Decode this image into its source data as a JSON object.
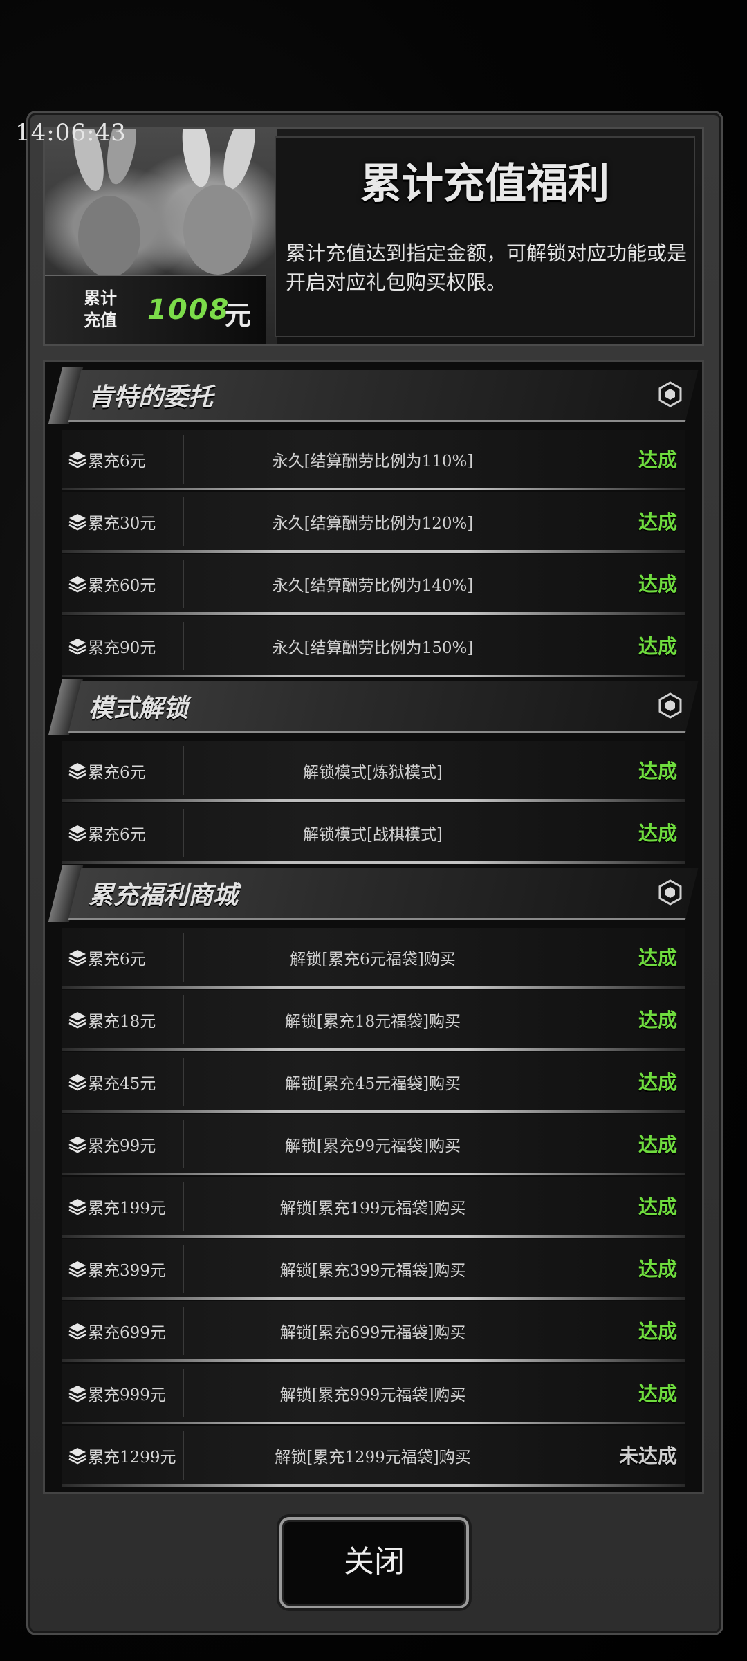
{
  "clock": "14:06:43",
  "header": {
    "title": "累计充值福利",
    "description": "累计充值达到指定金额，可解锁对应功能或是开启对应礼包购买权限。",
    "amount_label_line1": "累计",
    "amount_label_line2": "充值",
    "amount_value": "1008",
    "amount_unit": "元"
  },
  "sections": [
    {
      "title": "肯特的委托",
      "rows": [
        {
          "requirement": "累充6元",
          "description": "永久[结算酬劳比例为110%]",
          "status": "达成"
        },
        {
          "requirement": "累充30元",
          "description": "永久[结算酬劳比例为120%]",
          "status": "达成"
        },
        {
          "requirement": "累充60元",
          "description": "永久[结算酬劳比例为140%]",
          "status": "达成"
        },
        {
          "requirement": "累充90元",
          "description": "永久[结算酬劳比例为150%]",
          "status": "达成"
        }
      ]
    },
    {
      "title": "模式解锁",
      "rows": [
        {
          "requirement": "累充6元",
          "description": "解锁模式[炼狱模式]",
          "status": "达成"
        },
        {
          "requirement": "累充6元",
          "description": "解锁模式[战棋模式]",
          "status": "达成"
        }
      ]
    },
    {
      "title": "累充福利商城",
      "rows": [
        {
          "requirement": "累充6元",
          "description": "解锁[累充6元福袋]购买",
          "status": "达成"
        },
        {
          "requirement": "累充18元",
          "description": "解锁[累充18元福袋]购买",
          "status": "达成"
        },
        {
          "requirement": "累充45元",
          "description": "解锁[累充45元福袋]购买",
          "status": "达成"
        },
        {
          "requirement": "累充99元",
          "description": "解锁[累充99元福袋]购买",
          "status": "达成"
        },
        {
          "requirement": "累充199元",
          "description": "解锁[累充199元福袋]购买",
          "status": "达成"
        },
        {
          "requirement": "累充399元",
          "description": "解锁[累充399元福袋]购买",
          "status": "达成"
        },
        {
          "requirement": "累充699元",
          "description": "解锁[累充699元福袋]购买",
          "status": "达成"
        },
        {
          "requirement": "累充999元",
          "description": "解锁[累充999元福袋]购买",
          "status": "达成"
        },
        {
          "requirement": "累充1299元",
          "description": "解锁[累充1299元福袋]购买",
          "status": "未达成"
        }
      ]
    }
  ],
  "close_button": "关闭",
  "colors": {
    "achieved": "#6fdc3e",
    "not_achieved": "#cfcfcf",
    "amount": "#7cdc4a"
  },
  "icons": {
    "row_icon": "layers-icon",
    "section_icon": "hexagon-icon"
  }
}
